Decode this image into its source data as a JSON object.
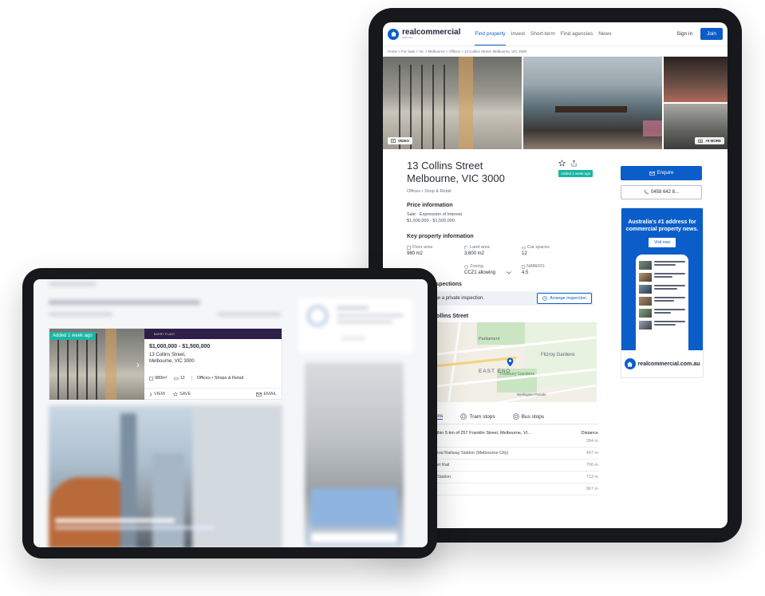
{
  "big": {
    "nav": {
      "logo_text": "realcommercial",
      "logo_sub": "com.au",
      "links": [
        "Find property",
        "Invest",
        "Short-term",
        "Find agencies",
        "News"
      ],
      "signin": "Sign in",
      "join": "Join"
    },
    "breadcrumb": "Home  >  For Sale  >  Vic  >  Melbourne  >  Offices  >  13 Collins Street, Melbourne, VIC 3000",
    "gallery": {
      "video_label": "VIDEO",
      "more_label": "+9 MORE"
    },
    "title_line1": "13 Collins Street",
    "title_line2": "Melbourne, VIC 3000",
    "subcategory": "Offices • Shop & Retail",
    "added_badge": "Added 1 week ago",
    "price": {
      "heading": "Price information",
      "line1": "Sale - Expression of Interest",
      "line2": "$1,000,000 - $1,500,000"
    },
    "key_info": {
      "heading": "Key property information",
      "items": [
        {
          "label": "Floor area",
          "value": "980 m2"
        },
        {
          "label": "Land area",
          "value": "3,600 m2"
        },
        {
          "label": "Car spaces",
          "value": "12"
        },
        {
          "label": "Car space extent",
          "value": "g"
        },
        {
          "label": "Zoning",
          "value": "CCZ1 allowing"
        },
        {
          "label": "NABERS",
          "value": "4.5"
        }
      ]
    },
    "inspections": {
      "heading": "nspections",
      "text_link": "ent",
      "text": "arrange a private inspection.",
      "button": "Arrange inspection"
    },
    "location": {
      "heading": "Collins Street",
      "labels": [
        "Parliament",
        "Fitzroy Gardens",
        "EAST END",
        "Treasury Gardens",
        "Wellington Parade",
        "entral"
      ]
    },
    "tabs": [
      "ations",
      "Tram stops",
      "Bus stops"
    ],
    "distance": {
      "head_left": "s within 5 km of 257 Franklin Street, Melbourne, VI...",
      "head_right": "Distance",
      "rows": [
        {
          "name": "tion",
          "d": "284 m"
        },
        {
          "name": "Central Railway Station (Melbourne City)",
          "d": "497 m"
        },
        {
          "name": "arport Rail",
          "d": "706 m"
        },
        {
          "name": "oss Station",
          "d": "713 m"
        },
        {
          "name": "nk",
          "d": "967 m"
        }
      ]
    },
    "enquire": "Enquire",
    "phone": "0458 642 8...",
    "ad": {
      "title": "Australia's #1 address for commercial property news.",
      "button": "Visit now",
      "footer": "realcommercial.com.au"
    }
  },
  "small": {
    "added": "Added 1 week ago",
    "brand": "BARRY PLANT",
    "price": "$1,000,000 - $1,500,000",
    "addr1": "13 Collins Street,",
    "addr2": "Melbourne, VIC 3000",
    "area": "980m²",
    "cars": "12",
    "tag": "Offices • Shops & Retail",
    "view": "VIEW",
    "save": "SAVE",
    "email": "EMAIL"
  }
}
